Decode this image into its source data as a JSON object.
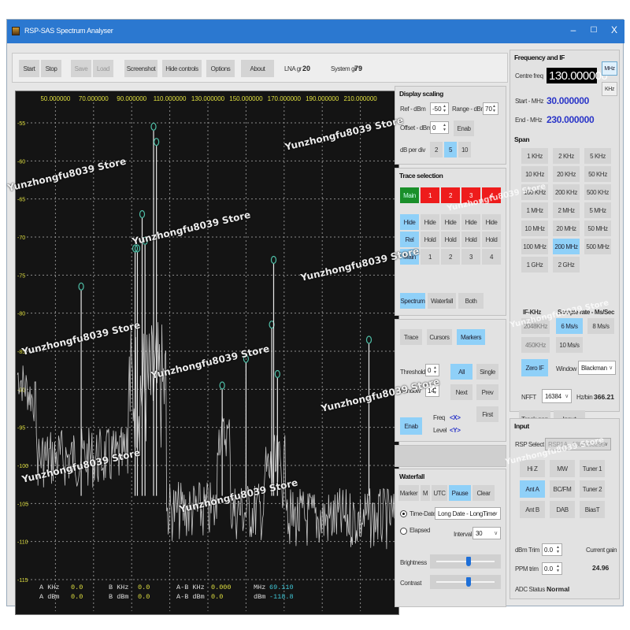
{
  "window": {
    "title": "RSP-SAS Spectrum Analyser",
    "controls": {
      "minimize": "–",
      "maximize": "☐",
      "close": "X"
    }
  },
  "toolbar": {
    "start": "Start",
    "stop": "Stop",
    "save": "Save",
    "load": "Load",
    "screenshot": "Screenshot",
    "hide_controls": "Hide controls",
    "options": "Options",
    "about": "About",
    "lna_label": "LNA gr",
    "lna_value": "20",
    "system_label": "System gr",
    "system_value": "79"
  },
  "spectrum": {
    "x_ticks": [
      "50.000000",
      "70.000000",
      "90.000000",
      "110.000000",
      "130.000000",
      "150.000000",
      "170.000000",
      "190.000000",
      "210.000000"
    ],
    "y_ticks": [
      "-55",
      "-60",
      "-65",
      "-70",
      "-75",
      "-80",
      "-85",
      "-90",
      "-95",
      "-100",
      "-105",
      "-110",
      "-115"
    ],
    "x_range_mhz": [
      30,
      230
    ],
    "y_range_dbm": [
      -120,
      -50
    ],
    "peaks": [
      {
        "freq": 63.5,
        "level": -76.5
      },
      {
        "freq": 91.8,
        "level": -71.5
      },
      {
        "freq": 93.0,
        "level": -71.5
      },
      {
        "freq": 95.5,
        "level": -67.0
      },
      {
        "freq": 97.0,
        "level": -70.5
      },
      {
        "freq": 101.5,
        "level": -55.5
      },
      {
        "freq": 103.0,
        "level": -57.5
      },
      {
        "freq": 137.5,
        "level": -89.5
      },
      {
        "freq": 150.0,
        "level": -86.0
      },
      {
        "freq": 163.5,
        "level": -81.5
      },
      {
        "freq": 164.5,
        "level": -73.0
      },
      {
        "freq": 166.5,
        "level": -88.0
      },
      {
        "freq": 214.5,
        "level": -83.5
      }
    ],
    "readout": {
      "a_khz_label": "A KHz",
      "a_khz": "0.0",
      "a_dbm_label": "A dBm",
      "a_dbm": "0.0",
      "b_khz_label": "B KHz",
      "b_khz": "0.0",
      "b_dbm_label": "B dBm",
      "b_dbm": "0.0",
      "ab_khz_label": "A-B KHz",
      "ab_khz": "0.000",
      "ab_dbm_label": "A-B dBm",
      "ab_dbm": "0.0",
      "mhz_label": "MHz",
      "mhz": "69.110",
      "dbm_label": "dBm",
      "dbm": "-118.8"
    },
    "colors": {
      "background": "#141414",
      "grid": "#8a8a8a",
      "tick": "#e0e040",
      "trace": "#e8e8e8",
      "marker": "#4fc0a8",
      "cursor_value": "#40c8d8"
    }
  },
  "display_scaling": {
    "title": "Display scaling",
    "ref_label": "Ref - dBm",
    "ref_value": "-50",
    "range_label": "Range - dBm",
    "range_value": "70",
    "offset_label": "Offset - dBm",
    "offset_value": "0",
    "enab": "Enab",
    "db_per_div_label": "dB per div",
    "db_per_div_options": [
      "2",
      "5",
      "10"
    ],
    "db_per_div_selected": "5"
  },
  "trace_selection": {
    "title": "Trace selection",
    "traces": [
      "Main",
      "1",
      "2",
      "3",
      "4"
    ],
    "hide_row": [
      "Hide",
      "Hide",
      "Hide",
      "Hide",
      "Hide"
    ],
    "hold_row": [
      "Rel",
      "Hold",
      "Hold",
      "Hold",
      "Hold"
    ],
    "source_row": [
      "Main",
      "1",
      "2",
      "3",
      "4"
    ],
    "view_buttons": [
      "Spectrum",
      "Waterfall",
      "Both"
    ],
    "view_selected": "Spectrum"
  },
  "markers": {
    "tabs": [
      "Trace",
      "Cursors",
      "Markers"
    ],
    "tab_selected": "Markers",
    "threshold_label": "Threshold",
    "threshold_value": "0",
    "window_label": "Window",
    "window_value": "14",
    "all": "All",
    "single": "Single",
    "next": "Next",
    "prev": "Prev",
    "first": "First",
    "enab": "Enab",
    "freq_label": "Freq",
    "freq_value": "<X>",
    "level_label": "Level",
    "level_value": "<Y>"
  },
  "waterfall": {
    "title": "Waterfall",
    "buttons": [
      "Marker",
      "M",
      "UTC",
      "Pause",
      "Clear"
    ],
    "selected": "Pause",
    "time_date_label": "Time-Date",
    "time_date_format": "Long Date - LongTime",
    "elapsed_label": "Elapsed",
    "interval_label": "Interval",
    "interval_value": "30",
    "brightness_label": "Brightness",
    "brightness_level": 0.55,
    "contrast_label": "Contrast",
    "contrast_level": 0.55
  },
  "frequency": {
    "title": "Frequency and IF",
    "centre_label": "Centre freq",
    "centre_value": "130.000000",
    "unit_mhz": "MHz",
    "unit_khz": "KHz",
    "start_label": "Start - MHz",
    "start_value": "30.000000",
    "end_label": "End - MHz",
    "end_value": "230.000000"
  },
  "span": {
    "title": "Span",
    "options": [
      "1 KHz",
      "2 KHz",
      "5 KHz",
      "10 KHz",
      "20 KHz",
      "50 KHz",
      "100 KHz",
      "200 KHz",
      "500 KHz",
      "1 MHz",
      "2 MHz",
      "5 MHz",
      "10 MHz",
      "20 MHz",
      "50 MHz",
      "100 MHz",
      "200 MHz",
      "500 MHz",
      "1 GHz",
      "2 GHz"
    ],
    "selected": "200 MHz"
  },
  "if_sampling": {
    "if_label": "IF-KHz",
    "sample_label": "Sample rate - Ms/Sec",
    "if_options": [
      "2048KHz",
      "450KHz",
      "Zero IF"
    ],
    "if_selected": "Zero IF",
    "rate_options": [
      "6 Ms/s",
      "8 Ms/s",
      "10 Ms/s"
    ],
    "rate_selected": "6 Ms/s",
    "window_label": "Window",
    "window_value": "Blackman",
    "nfft_label": "NFFT",
    "nfft_value": "16384",
    "hzbin_label": "Hz/bin",
    "hzbin_value": "366.21",
    "track_gen": "Track gen",
    "input": "Input"
  },
  "input": {
    "title": "Input",
    "rsp_label": "RSP Select",
    "rsp_value": "RSP1A - 1804063295",
    "buttons": [
      "Hi Z",
      "MW",
      "Tuner 1",
      "Ant A",
      "BC/FM",
      "Tuner 2",
      "Ant B",
      "DAB",
      "BiasT"
    ],
    "selected": "Ant A",
    "dbm_trim_label": "dBm Trim",
    "dbm_trim_value": "0.0",
    "ppm_trim_label": "PPM trim",
    "ppm_trim_value": "0.0",
    "current_gain_label": "Current gain",
    "current_gain_value": "24.96",
    "adc_label": "ADC Status",
    "adc_value": "Normal"
  },
  "watermark": "Yunzhongfu8039 Store"
}
